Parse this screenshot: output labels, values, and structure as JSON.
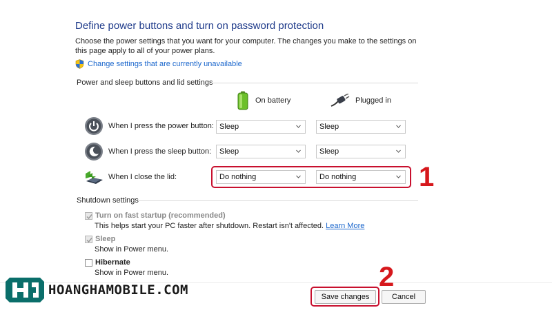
{
  "header": {
    "title": "Define power buttons and turn on password protection",
    "description": "Choose the power settings that you want for your computer. The changes you make to the settings on this page apply to all of your power plans.",
    "change_link": "Change settings that are currently unavailable",
    "shield_icon": "uac-shield-icon"
  },
  "power_section": {
    "label": "Power and sleep buttons and lid settings",
    "col_battery": "On battery",
    "col_plugged": "Plugged in",
    "rows": [
      {
        "label": "When I press the power button:",
        "icon": "power-button-icon",
        "battery": "Sleep",
        "plugged": "Sleep"
      },
      {
        "label": "When I press the sleep button:",
        "icon": "sleep-button-icon",
        "battery": "Sleep",
        "plugged": "Sleep"
      },
      {
        "label": "When I close the lid:",
        "icon": "laptop-lid-icon",
        "battery": "Do nothing",
        "plugged": "Do nothing"
      }
    ]
  },
  "shutdown_section": {
    "label": "Shutdown settings",
    "items": [
      {
        "label": "Turn on fast startup (recommended)",
        "sub": "This helps start your PC faster after shutdown. Restart isn't affected.",
        "link": "Learn More",
        "checked": true,
        "disabled": true
      },
      {
        "label": "Sleep",
        "sub": "Show in Power menu.",
        "checked": true,
        "disabled": true
      },
      {
        "label": "Hibernate",
        "sub": "Show in Power menu.",
        "checked": false,
        "disabled": false
      }
    ]
  },
  "buttons": {
    "save": "Save changes",
    "cancel": "Cancel"
  },
  "annotations": {
    "step1": "1",
    "step2": "2",
    "color": "#c8102e"
  },
  "watermark": {
    "text": "HOANGHAMOBILE.COM",
    "color": "#0a6e6a"
  }
}
